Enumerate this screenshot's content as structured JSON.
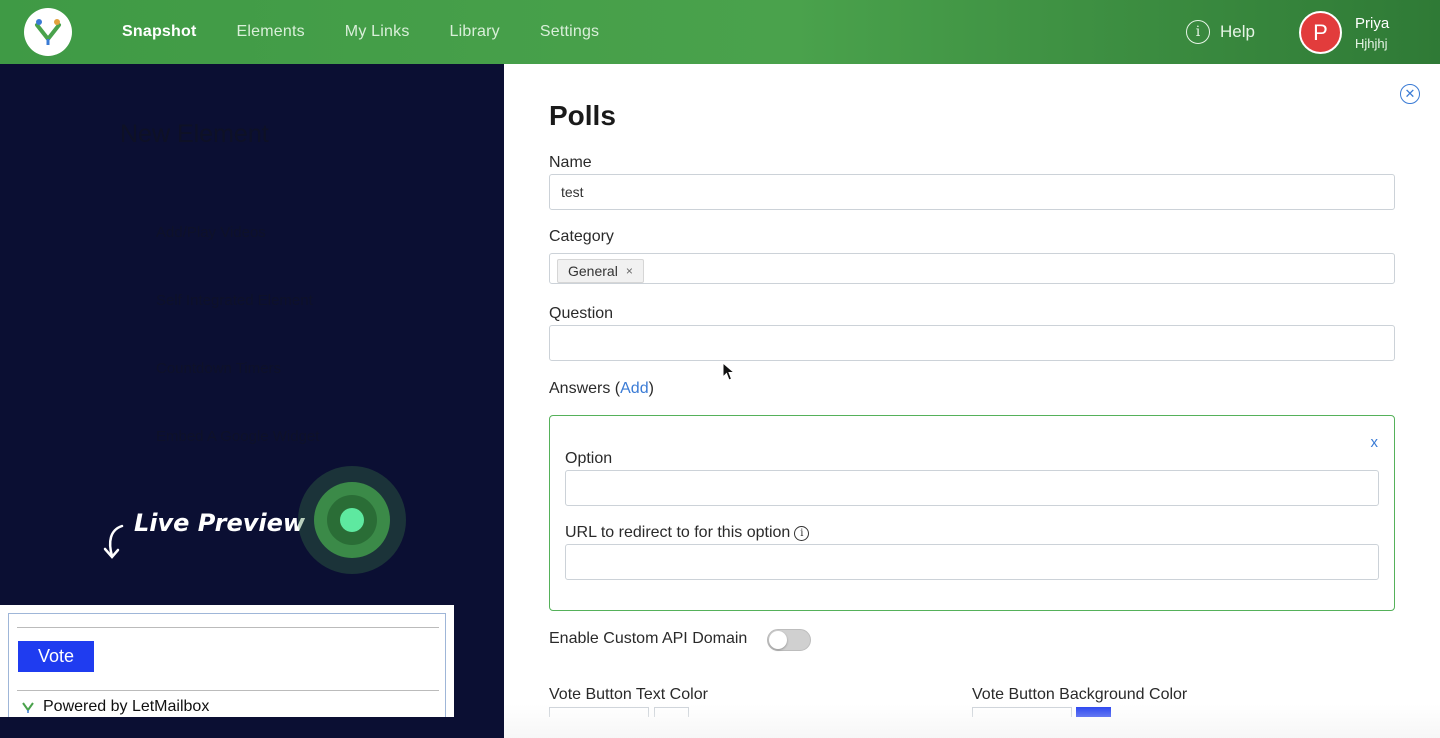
{
  "nav": {
    "items": [
      "Snapshot",
      "Elements",
      "My Links",
      "Library",
      "Settings"
    ],
    "active_index": 0,
    "help_label": "Help",
    "help_icon": "info-icon",
    "user": {
      "initial": "P",
      "name": "Priya",
      "subtitle": "Hjhjhj"
    },
    "colors": {
      "bar": "#45a049",
      "avatar": "#e23c3c"
    }
  },
  "background": {
    "title": "New Element",
    "items": [
      "Add/Play Videos",
      "Self Integrated Element",
      "Countdown Timers",
      "Embed A Google Widget"
    ]
  },
  "live_preview": {
    "label": "Live Preview",
    "vote_label": "Vote",
    "powered_by": "Powered by LetMailbox",
    "colors": {
      "vote_button": "#1f3cf0",
      "pulse_core": "#5ee9a0"
    }
  },
  "form": {
    "title": "Polls",
    "name_label": "Name",
    "name_value": "test",
    "category_label": "Category",
    "category_tag": "General",
    "category_tag_remove": "×",
    "question_label": "Question",
    "question_value": "",
    "answers_label_prefix": "Answers (",
    "answers_add_link": "Add",
    "answers_label_suffix": ")",
    "answer": {
      "remove_label": "x",
      "option_label": "Option",
      "option_value": "",
      "url_label": "URL to redirect to for this option",
      "url_value": ""
    },
    "custom_api_label": "Enable Custom API Domain",
    "custom_api_enabled": false,
    "vote_text_color_label": "Vote Button Text Color",
    "vote_bg_color_label": "Vote Button Background Color",
    "colors": {
      "answer_border": "#55b15a",
      "link": "#3a7bd5",
      "vote_bg_swatch": "#1f3cf0"
    }
  }
}
